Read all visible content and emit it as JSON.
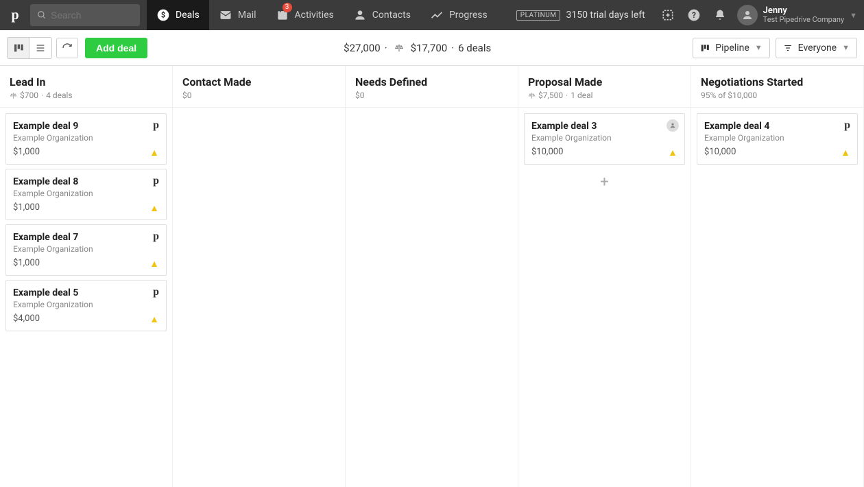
{
  "nav": {
    "search_placeholder": "Search",
    "items": {
      "deals": "Deals",
      "mail": "Mail",
      "activities": "Activities",
      "contacts": "Contacts",
      "progress": "Progress"
    },
    "activities_badge": "3",
    "plan_tag": "PLATINUM",
    "trial_text": "3150 trial days left",
    "user_name": "Jenny",
    "user_company": "Test Pipedrive Company"
  },
  "toolbar": {
    "add_deal_label": "Add deal",
    "summary_total": "$27,000",
    "summary_weighted": "$17,700",
    "summary_deals": "6 deals",
    "pipeline_label": "Pipeline",
    "owner_label": "Everyone"
  },
  "columns": [
    {
      "title": "Lead In",
      "sub_amount": "$700",
      "sub_deals": "4 deals",
      "has_scale": true,
      "cards": [
        {
          "title": "Example deal 9",
          "org": "Example Organization",
          "amount": "$1,000",
          "logo": true,
          "warn": true
        },
        {
          "title": "Example deal 8",
          "org": "Example Organization",
          "amount": "$1,000",
          "logo": true,
          "warn": true
        },
        {
          "title": "Example deal 7",
          "org": "Example Organization",
          "amount": "$1,000",
          "logo": true,
          "warn": true
        },
        {
          "title": "Example deal 5",
          "org": "Example Organization",
          "amount": "$4,000",
          "logo": true,
          "warn": true
        }
      ],
      "show_add": false
    },
    {
      "title": "Contact Made",
      "sub_amount": "$0",
      "sub_deals": "",
      "has_scale": false,
      "cards": [],
      "show_add": false
    },
    {
      "title": "Needs Defined",
      "sub_amount": "$0",
      "sub_deals": "",
      "has_scale": false,
      "cards": [],
      "show_add": false
    },
    {
      "title": "Proposal Made",
      "sub_amount": "$7,500",
      "sub_deals": "1 deal",
      "has_scale": true,
      "cards": [
        {
          "title": "Example deal 3",
          "org": "Example Organization",
          "amount": "$10,000",
          "avatar": true,
          "warn": true
        }
      ],
      "show_add": true
    },
    {
      "title": "Negotiations Started",
      "sub_amount": "95% of $10,000",
      "sub_deals": "",
      "has_scale": false,
      "cards": [
        {
          "title": "Example deal 4",
          "org": "Example Organization",
          "amount": "$10,000",
          "logo": true,
          "warn": true
        }
      ],
      "show_add": false
    }
  ]
}
